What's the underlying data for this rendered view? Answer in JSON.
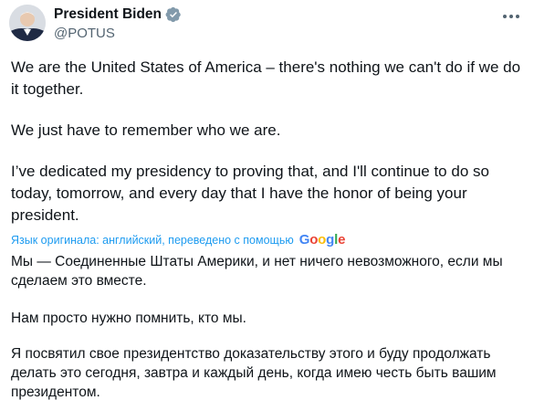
{
  "author": {
    "name": "President Biden",
    "handle": "@POTUS",
    "verified_color": "#829aab"
  },
  "tweet": {
    "paragraphs": [
      "We are the United States of America – there's nothing we can't do if we do it together.",
      "We just have to remember who we are.",
      "I’ve dedicated my presidency to proving that, and I'll continue to do so today, tomorrow, and every day that I have the honor of being your president."
    ]
  },
  "translation": {
    "note": "Язык оригинала: английский, переведено с помощью",
    "provider": "Google",
    "paragraphs": [
      "Мы — Соединенные Штаты Америки, и нет ничего невозможного, если мы сделаем это вместе.",
      "Нам просто нужно помнить, кто мы.",
      "Я посвятил свое президентство доказательству этого и буду продолжать делать это сегодня, завтра и каждый день, когда имею честь быть вашим президентом."
    ]
  },
  "icons": {
    "more": "more-options-icon",
    "verified": "verified-badge-icon"
  }
}
